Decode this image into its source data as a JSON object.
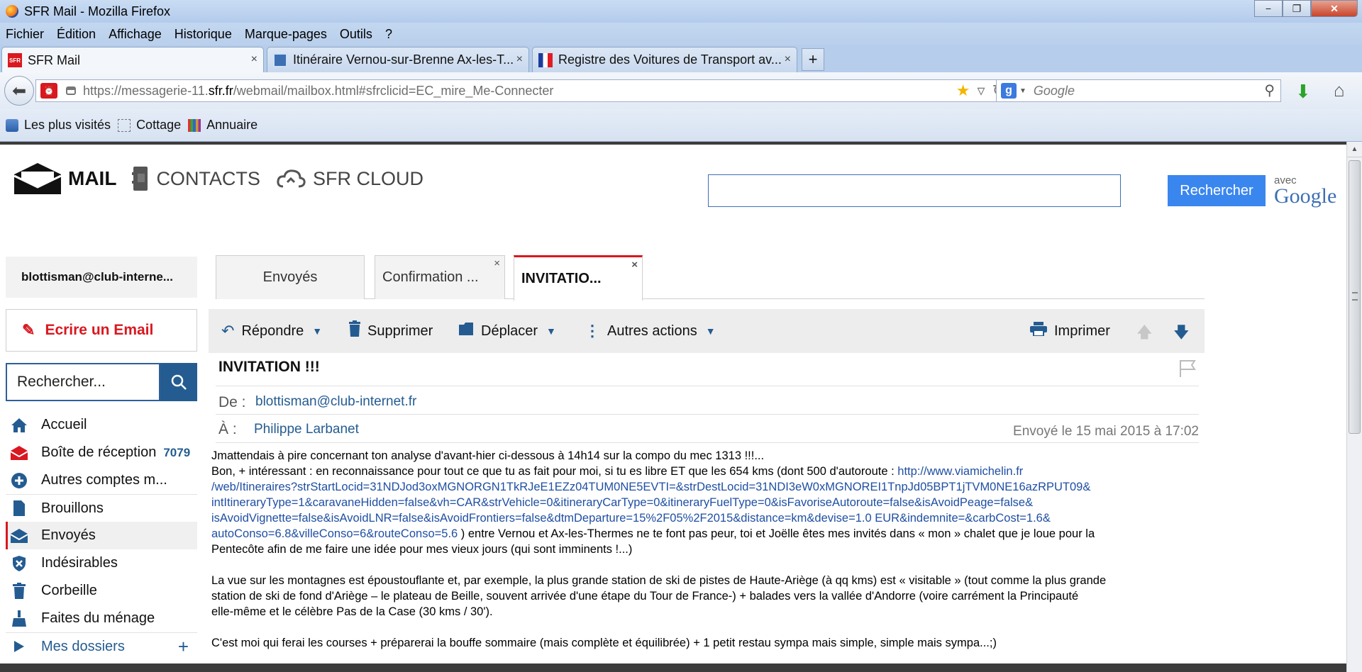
{
  "window": {
    "title": "SFR Mail - Mozilla Firefox",
    "buttons": [
      "−",
      "❐",
      "✕"
    ]
  },
  "menu": [
    "Fichier",
    "Édition",
    "Affichage",
    "Historique",
    "Marque-pages",
    "Outils",
    "?"
  ],
  "tabs": [
    {
      "label": "SFR Mail",
      "icon": "sfr-favicon",
      "close": "×"
    },
    {
      "label": "Itinéraire Vernou-sur-Brenne Ax-les-T...",
      "icon": "map-favicon",
      "close": "×"
    },
    {
      "label": "Registre des Voitures de Transport av...",
      "icon": "france-flag-favicon",
      "close": "×"
    }
  ],
  "new_tab": "+",
  "address": {
    "prefix": "https://messagerie-11.",
    "domain": "sfr.fr",
    "suffix": "/webmail/mailbox.html#sfrclicid=EC_mire_Me-Connecter"
  },
  "search_engine": {
    "placeholder": "Google"
  },
  "bookmarks": [
    "Les plus visités",
    "Cottage",
    "Annuaire"
  ],
  "sfr_nav": {
    "mail": "MAIL",
    "contacts": "CONTACTS",
    "cloud": "SFR CLOUD"
  },
  "top_search": {
    "button": "Rechercher",
    "avec": "avec",
    "google": "Google"
  },
  "sidebar": {
    "account": "blottisman@club-interne...",
    "write": "Ecrire un Email",
    "search_placeholder": "Rechercher...",
    "folders": [
      {
        "label": "Accueil",
        "icon": "home-icon"
      },
      {
        "label": "Boîte de réception",
        "icon": "inbox-icon",
        "count": "7079"
      },
      {
        "label": "Autres comptes m...",
        "icon": "add-circle-icon"
      },
      {
        "label": "Brouillons",
        "icon": "draft-icon"
      },
      {
        "label": "Envoyés",
        "icon": "sent-icon"
      },
      {
        "label": "Indésirables",
        "icon": "shield-icon"
      },
      {
        "label": "Corbeille",
        "icon": "trash-icon"
      },
      {
        "label": "Faites du ménage",
        "icon": "broom-icon"
      },
      {
        "label": "Mes dossiers",
        "icon": "play-icon",
        "action": "+"
      }
    ]
  },
  "mail_tabs": [
    {
      "label": "Envoyés"
    },
    {
      "label": "Confirmation ...",
      "close": "×"
    },
    {
      "label": "INVITATIO...",
      "close": "×"
    }
  ],
  "toolbar": {
    "reply": "Répondre",
    "delete": "Supprimer",
    "move": "Déplacer",
    "more": "Autres actions",
    "print": "Imprimer"
  },
  "message": {
    "subject": "INVITATION !!!",
    "from_label": "De :",
    "from": "blottisman@club-internet.fr",
    "to_label": "À :",
    "to": "Philippe Larbanet",
    "sent": "Envoyé le 15 mai 2015 à 17:02",
    "p1_line1": "Jmattendais à pire concernant ton analyse d'avant-hier ci-dessous à 14h14 sur la compo du mec 1313 !!!...",
    "p1_line2_start": "Bon, + intéressant : en reconnaissance pour tout ce que tu as fait pour moi, si tu es libre ET que les 654 kms  (dont 500 d'autoroute : ",
    "link_parts": [
      "http://www.viamichelin.fr",
      "/web/Itineraires?strStartLocid=31NDJod3oxMGNORGN1TkRJeE1EZz04TUM0NE5EVTI=&strDestLocid=31NDI3eW0xMGNOREI1TnpJd05BPT1jTVM0NE16azRPUT09&",
      "intItineraryType=1&caravaneHidden=false&vh=CAR&strVehicle=0&itineraryCarType=0&itineraryFuelType=0&isFavoriseAutoroute=false&isAvoidPeage=false&",
      "isAvoidVignette=false&isAvoidLNR=false&isAvoidFrontiers=false&dtmDeparture=15%2F05%2F2015&distance=km&devise=1.0 EUR&indemnite=&carbCost=1.6&",
      "autoConso=6.8&villeConso=6&routeConso=5.6"
    ],
    "p1_after_link": "   ) entre Vernou et Ax-les-Thermes ne te font pas peur, toi et Joëlle êtes mes invités dans « mon » chalet que je loue pour la",
    "p1_last": "Pentecôte afin de me faire une idée pour mes vieux jours (qui sont imminents !...)",
    "p2_l1": "La vue sur les montagnes est époustouflante et, par exemple, la plus grande station de ski  de pistes de Haute-Ariège (à qq kms) est « visitable » (tout comme la plus grande",
    "p2_l2": "station de ski de fond d'Ariège – le plateau de Beille, souvent arrivée d'une étape du Tour de France-) + balades vers la vallée d'Andorre (voire carrément la Principauté",
    "p2_l3": "elle-même et le célèbre  Pas de la Case (30 kms / 30').",
    "p3": "C'est moi qui ferai les courses + préparerai la bouffe sommaire (mais complète et équilibrée) + 1 petit restau sympa mais simple, simple mais sympa...;)"
  }
}
